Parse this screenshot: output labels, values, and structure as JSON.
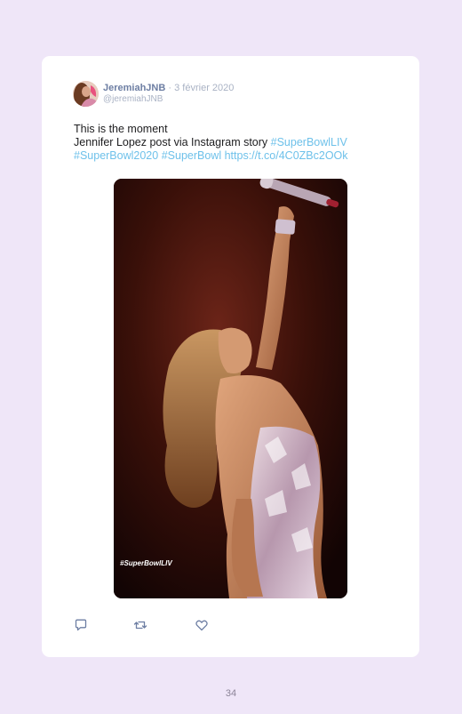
{
  "tweet": {
    "author_name": "JeremiahJNB",
    "separator": "·",
    "date": "3 février 2020",
    "handle": "@jeremiahJNB",
    "text_line1": "This is the moment",
    "text_line2_prefix": "Jennifer Lopez post via Instagram story ",
    "hashtag_superbowlliv": "#SuperBowlLIV",
    "hashtag_superbowl2020": "#SuperBowl2020",
    "hashtag_superbowl": "#SuperBowl",
    "link": "https://t.co/4C0ZBc2OOk",
    "media_caption": "#SuperBowlLIV"
  },
  "actions": {
    "reply_icon": "reply-icon",
    "retweet_icon": "retweet-icon",
    "like_icon": "heart-icon"
  },
  "colors": {
    "background": "#efe6f8",
    "card": "#ffffff",
    "author_name": "#6d7ea3",
    "link": "#6ec1ea",
    "muted": "#a9b2c4",
    "icon": "#6d7ea3"
  },
  "footer": {
    "page_number": "34"
  }
}
